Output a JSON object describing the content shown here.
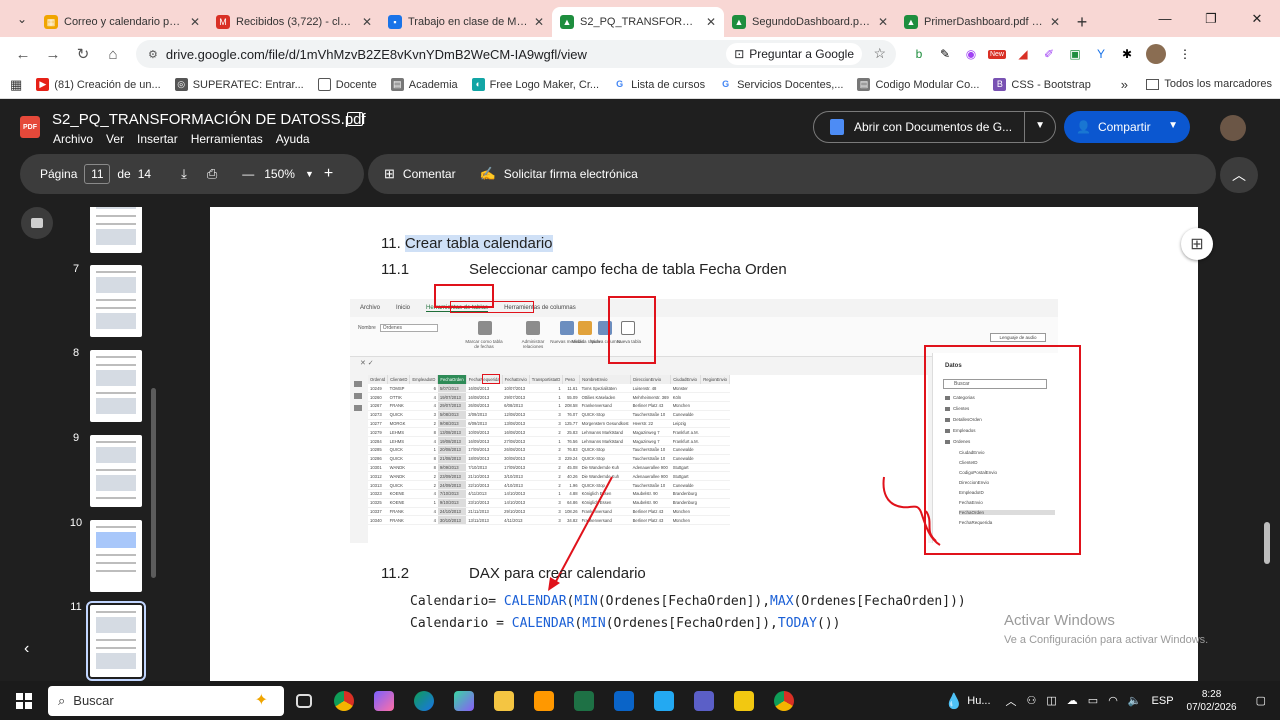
{
  "browser": {
    "tabs": [
      {
        "title": "Correo y calendario perso",
        "color": "#f0a500"
      },
      {
        "title": "Recibidos (3,722) - clz.carl",
        "color": "#d93025"
      },
      {
        "title": "Trabajo en clase de Model",
        "color": "#1a73e8"
      },
      {
        "title": "S2_PQ_TRANSFORMACIÓN",
        "color": "#1e8e3e"
      },
      {
        "title": "SegundoDashboard.pdf -",
        "color": "#1e8e3e"
      },
      {
        "title": "PrimerDashboard.pdf - Go",
        "color": "#1e8e3e"
      }
    ],
    "url": "drive.google.com/file/d/1mVhMzvB2ZE8vKvnYDmB2WeCM-IA9wgfl/view",
    "ask_google": "Preguntar a Google",
    "bookmarks": [
      "(81) Creación de un...",
      "SUPERATEC: Entrar...",
      "Docente",
      "Academia",
      "Free Logo Maker, Cr...",
      "Lista de cursos",
      "Servicios Docentes,...",
      "Codigo Modular Co...",
      "CSS - Bootstrap"
    ],
    "all_bookmarks": "Todos los marcadores"
  },
  "drive": {
    "file_title": "S2_PQ_TRANSFORMACIÓN DE DATOSS.pdf",
    "menus": [
      "Archivo",
      "Ver",
      "Insertar",
      "Herramientas",
      "Ayuda"
    ],
    "open_with": "Abrir con Documentos de G...",
    "share": "Compartir",
    "toolbar": {
      "page_label": "Página",
      "page_current": "11",
      "page_of": "de",
      "page_total": "14",
      "zoom": "150%",
      "comment": "Comentar",
      "sign": "Solicitar firma electrónica"
    },
    "thumbnails": [
      {
        "num": "7"
      },
      {
        "num": "8"
      },
      {
        "num": "9"
      },
      {
        "num": "10"
      },
      {
        "num": "11"
      }
    ]
  },
  "document": {
    "h11_num": "11.",
    "h11_text": "Crear tabla calendario",
    "h111_num": "11.1",
    "h111_text": "Seleccionar campo fecha de tabla Fecha Orden",
    "h112_num": "11.2",
    "h112_text": "DAX para crear calendario",
    "code_lines": [
      {
        "lhs": "Calendario= ",
        "fn": "CALENDAR",
        "p1": "(",
        "min": "MIN",
        "a1": "(Ordenes[FechaOrden]),",
        "max": "MAX",
        "a2": "(Ordenes[FechaOrden]))"
      },
      {
        "lhs": "Calendario = ",
        "fn": "CALENDAR",
        "p1": "(",
        "min": "MIN",
        "a1": "(Ordenes[FechaOrden]),",
        "max": "TODAY",
        "a2": "())"
      }
    ]
  },
  "powerbi": {
    "ribbon_tabs": [
      "Archivo",
      "Inicio",
      "Herramientas de tablas",
      "Herramientas de columnas"
    ],
    "name_label": "Nombre",
    "name_value": "Ordenes",
    "ribbon_buttons": [
      "Marcar como tabla de fechas",
      "Administrar relaciones",
      "Nuevas medidas",
      "Medida rápida",
      "Nueva columna",
      "Nueva tabla"
    ],
    "language_btn": "Lenguaje de audio",
    "columns": [
      "OrdenId",
      "ClienteID",
      "EmpleadoID",
      "FechaOrden",
      "FechaRequerida",
      "FechaEnvio",
      "TransportistaID",
      "Peso",
      "NombreEnvio",
      "DireccionEnvio",
      "CiudadEnvio",
      "RegionEnvio"
    ],
    "rows": [
      [
        "10249",
        "TOMSP",
        "6",
        "5/07/2013",
        "16/08/2013",
        "10/07/2013",
        "1",
        "11.61",
        "Toms Spezialitäten",
        "Luisenstr. 48",
        "Münster",
        ""
      ],
      [
        "10260",
        "OTTIK",
        "4",
        "19/07/2013",
        "16/08/2013",
        "29/07/2013",
        "1",
        "55.09",
        "Ottilies Käseladen",
        "Mehrheimerstr. 369",
        "Köln",
        ""
      ],
      [
        "10267",
        "FRANK",
        "4",
        "29/07/2013",
        "26/08/2013",
        "6/08/2013",
        "1",
        "208.58",
        "Frankenversand",
        "Berliner Platz 43",
        "München",
        ""
      ],
      [
        "10273",
        "QUICK",
        "3",
        "5/08/2013",
        "2/09/2013",
        "12/08/2013",
        "3",
        "76.07",
        "QUICK-Stop",
        "Taucherstraße 10",
        "Cunewalde",
        ""
      ],
      [
        "10277",
        "MORGK",
        "2",
        "9/08/2013",
        "6/09/2013",
        "13/08/2013",
        "3",
        "125.77",
        "Morgenstern Gesundkost",
        "Heerstr. 22",
        "Leipzig",
        ""
      ],
      [
        "10279",
        "LEHMS",
        "8",
        "13/08/2013",
        "10/09/2013",
        "16/08/2013",
        "2",
        "25.83",
        "Lehmanns Marktstand",
        "Magazinweg 7",
        "Frankfurt a.M.",
        ""
      ],
      [
        "10284",
        "LEHMS",
        "4",
        "19/08/2013",
        "16/09/2013",
        "27/08/2013",
        "1",
        "76.56",
        "Lehmanns Marktstand",
        "Magazinweg 7",
        "Frankfurt a.M.",
        ""
      ],
      [
        "10285",
        "QUICK",
        "1",
        "20/08/2013",
        "17/09/2013",
        "26/08/2013",
        "2",
        "76.83",
        "QUICK-Stop",
        "Taucherstraße 10",
        "Cunewalde",
        ""
      ],
      [
        "10286",
        "QUICK",
        "8",
        "21/08/2013",
        "18/09/2013",
        "30/08/2013",
        "3",
        "229.24",
        "QUICK-Stop",
        "Taucherstraße 10",
        "Cunewalde",
        ""
      ],
      [
        "10301",
        "WANDK",
        "8",
        "9/09/2013",
        "7/10/2013",
        "17/09/2013",
        "2",
        "45.08",
        "Die Wandernde Kuh",
        "Adenauerallee 900",
        "Stuttgart",
        ""
      ],
      [
        "10312",
        "WANDK",
        "2",
        "23/09/2013",
        "21/10/2013",
        "3/10/2013",
        "2",
        "40.26",
        "Die Wandernde Kuh",
        "Adenauerallee 900",
        "Stuttgart",
        ""
      ],
      [
        "10313",
        "QUICK",
        "2",
        "24/09/2013",
        "22/10/2013",
        "4/10/2013",
        "2",
        "1.96",
        "QUICK-Stop",
        "Taucherstraße 10",
        "Cunewalde",
        ""
      ],
      [
        "10323",
        "KOENE",
        "4",
        "7/10/2013",
        "4/11/2013",
        "14/10/2013",
        "1",
        "4.88",
        "Königlich Essen",
        "Maubelstr. 90",
        "Brandenburg",
        ""
      ],
      [
        "10325",
        "KOENE",
        "1",
        "9/10/2013",
        "23/10/2013",
        "14/10/2013",
        "3",
        "64.86",
        "Königlich Essen",
        "Maubelstr. 90",
        "Brandenburg",
        ""
      ],
      [
        "10337",
        "FRANK",
        "4",
        "24/10/2013",
        "21/11/2013",
        "29/10/2013",
        "3",
        "108.26",
        "Frankenversand",
        "Berliner Platz 43",
        "München",
        ""
      ],
      [
        "10340",
        "FRANK",
        "4",
        "30/10/2013",
        "13/11/2013",
        "4/11/2013",
        "3",
        "34.82",
        "Frankenversand",
        "Berliner Platz 43",
        "München",
        ""
      ]
    ],
    "data_pane": {
      "title": "Datos",
      "search": "Buscar",
      "tables": [
        "Categorias",
        "Clientes",
        "DetallesOrden",
        "Empleados",
        "Ordenes"
      ],
      "fields": [
        "CiudadEnvio",
        "ClienteID",
        "CodigoPostalEnvio",
        "DireccionEnvio",
        "EmpleadoID",
        "FechaEnvio",
        "FechaOrden",
        "FechaRequerida"
      ]
    }
  },
  "watermark": {
    "line1": "Activar Windows",
    "line2": "Ve a Configuración para activar Windows."
  },
  "taskbar": {
    "search": "Buscar",
    "weather": "Hu...",
    "lang": "ESP",
    "time": "8:28",
    "date": "07/02/2026"
  }
}
